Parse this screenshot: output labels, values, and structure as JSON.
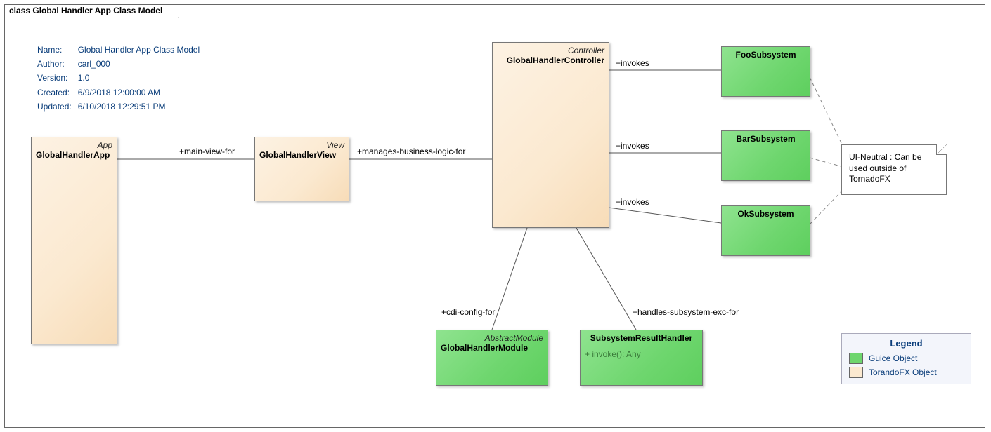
{
  "title": "class Global Handler App Class Model",
  "meta": {
    "name_k": "Name:",
    "name_v": "Global Handler App Class Model",
    "author_k": "Author:",
    "author_v": "carl_000",
    "version_k": "Version:",
    "version_v": "1.0",
    "created_k": "Created:",
    "created_v": "6/9/2018 12:00:00 AM",
    "updated_k": "Updated:",
    "updated_v": "6/10/2018 12:29:51 PM"
  },
  "nodes": {
    "app": {
      "stereo": "App",
      "name": "GlobalHandlerApp"
    },
    "view": {
      "stereo": "View",
      "name": "GlobalHandlerView"
    },
    "ctrl": {
      "stereo": "Controller",
      "name": "GlobalHandlerController"
    },
    "module": {
      "stereo": "AbstractModule",
      "name": "GlobalHandlerModule"
    },
    "srh": {
      "name": "SubsystemResultHandler",
      "op": "+    invoke(): Any"
    },
    "foo": {
      "name": "FooSubsystem"
    },
    "bar": {
      "name": "BarSubsystem"
    },
    "ok": {
      "name": "OkSubsystem"
    }
  },
  "edges": {
    "main_view_for": "+main-view-for",
    "manages": "+manages-business-logic-for",
    "invokes1": "+invokes",
    "invokes2": "+invokes",
    "invokes3": "+invokes",
    "cdi": "+cdi-config-for",
    "handles": "+handles-subsystem-exc-for"
  },
  "note": {
    "line1": "UI-Neutral : Can be",
    "line2": "used outside of",
    "line3": "TornadoFX"
  },
  "legend": {
    "title": "Legend",
    "guice": "Guice Object",
    "tornado": "TorandoFX Object"
  },
  "chart_data": {
    "type": "uml-class-diagram",
    "title": "Global Handler App Class Model",
    "classes": [
      {
        "id": "GlobalHandlerApp",
        "stereotype": "App",
        "category": "TorandoFX Object"
      },
      {
        "id": "GlobalHandlerView",
        "stereotype": "View",
        "category": "TorandoFX Object"
      },
      {
        "id": "GlobalHandlerController",
        "stereotype": "Controller",
        "category": "TorandoFX Object"
      },
      {
        "id": "GlobalHandlerModule",
        "stereotype": "AbstractModule",
        "category": "Guice Object"
      },
      {
        "id": "SubsystemResultHandler",
        "operations": [
          "invoke(): Any"
        ],
        "category": "Guice Object"
      },
      {
        "id": "FooSubsystem",
        "category": "Guice Object"
      },
      {
        "id": "BarSubsystem",
        "category": "Guice Object"
      },
      {
        "id": "OkSubsystem",
        "category": "Guice Object"
      }
    ],
    "associations": [
      {
        "from": "GlobalHandlerApp",
        "to": "GlobalHandlerView",
        "label": "main-view-for"
      },
      {
        "from": "GlobalHandlerView",
        "to": "GlobalHandlerController",
        "label": "manages-business-logic-for"
      },
      {
        "from": "GlobalHandlerController",
        "to": "FooSubsystem",
        "label": "invokes"
      },
      {
        "from": "GlobalHandlerController",
        "to": "BarSubsystem",
        "label": "invokes"
      },
      {
        "from": "GlobalHandlerController",
        "to": "OkSubsystem",
        "label": "invokes"
      },
      {
        "from": "GlobalHandlerController",
        "to": "GlobalHandlerModule",
        "label": "cdi-config-for"
      },
      {
        "from": "GlobalHandlerController",
        "to": "SubsystemResultHandler",
        "label": "handles-subsystem-exc-for"
      }
    ],
    "notes": [
      {
        "text": "UI-Neutral : Can be used outside of TornadoFX",
        "attachedTo": [
          "FooSubsystem",
          "BarSubsystem",
          "OkSubsystem"
        ]
      }
    ],
    "legend": [
      {
        "color": "green",
        "label": "Guice Object"
      },
      {
        "color": "peach",
        "label": "TorandoFX Object"
      }
    ]
  }
}
